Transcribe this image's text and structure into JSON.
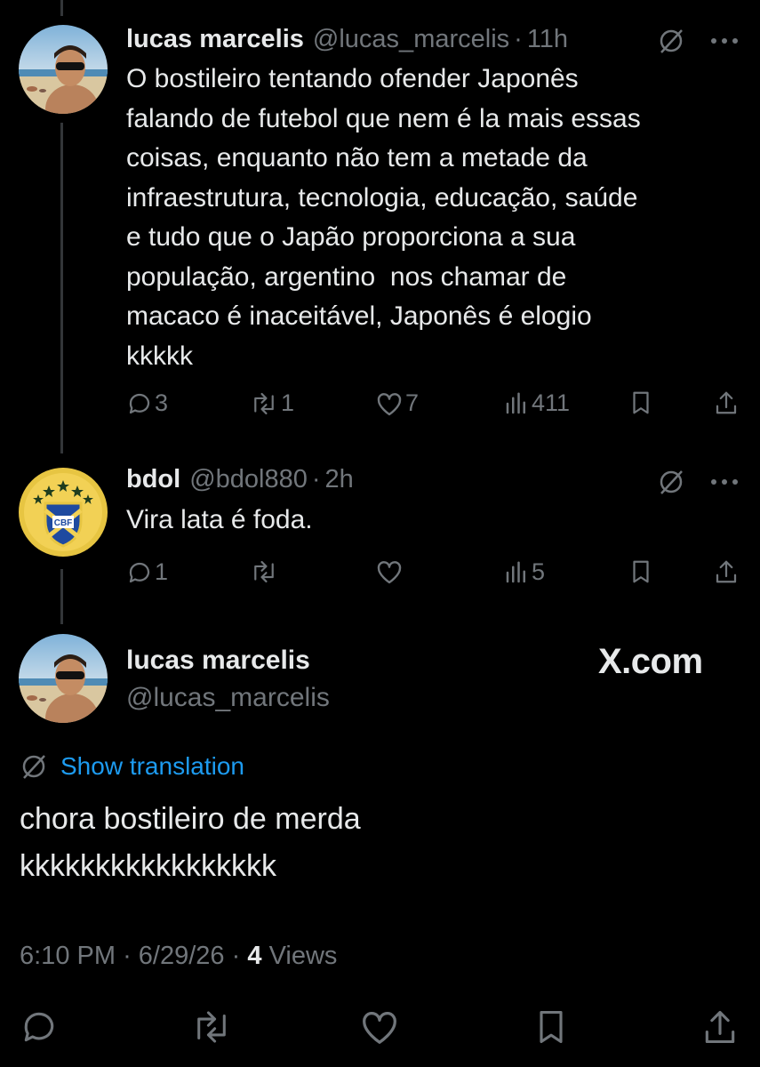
{
  "tweets": [
    {
      "name": "lucas marcelis",
      "handle": "@lucas_marcelis",
      "time": "11h",
      "text": "O bostileiro tentando ofender Japonês\nfalando de futebol que nem é la mais essas\ncoisas, enquanto não tem a metade da\ninfraestrutura, tecnologia, educação, saúde\ne tudo que o Japão proporciona a sua\npopulação, argentino  nos chamar de\nmacaco é inaceitável, Japonês é elogio\nkkkkk",
      "stats": {
        "replies": "3",
        "reposts": "1",
        "likes": "7",
        "views": "411"
      }
    },
    {
      "name": "bdol",
      "handle": "@bdol880",
      "time": "2h",
      "text": "Vira lata é foda.",
      "avatar_text": "CBF",
      "stats": {
        "replies": "1",
        "reposts": "",
        "likes": "",
        "views": "5"
      }
    }
  ],
  "main_tweet": {
    "name": "lucas marcelis",
    "handle": "@lucas_marcelis",
    "show_translation": "Show translation",
    "text": "chora bostileiro de merda\nkkkkkkkkkkkkkkkkk",
    "time": "6:10 PM",
    "date": "6/29/26",
    "views_count": "4",
    "views_label": "Views"
  },
  "watermark": "X.com",
  "separator": "·",
  "colors": {
    "background": "#000000",
    "text": "#e7e9ea",
    "secondary": "#71767b",
    "link": "#1d9bf0",
    "thread_line": "#333639"
  },
  "icons": [
    "reply-icon",
    "repost-icon",
    "like-icon",
    "views-icon",
    "bookmark-icon",
    "share-icon",
    "translate-icon",
    "more-icon"
  ]
}
